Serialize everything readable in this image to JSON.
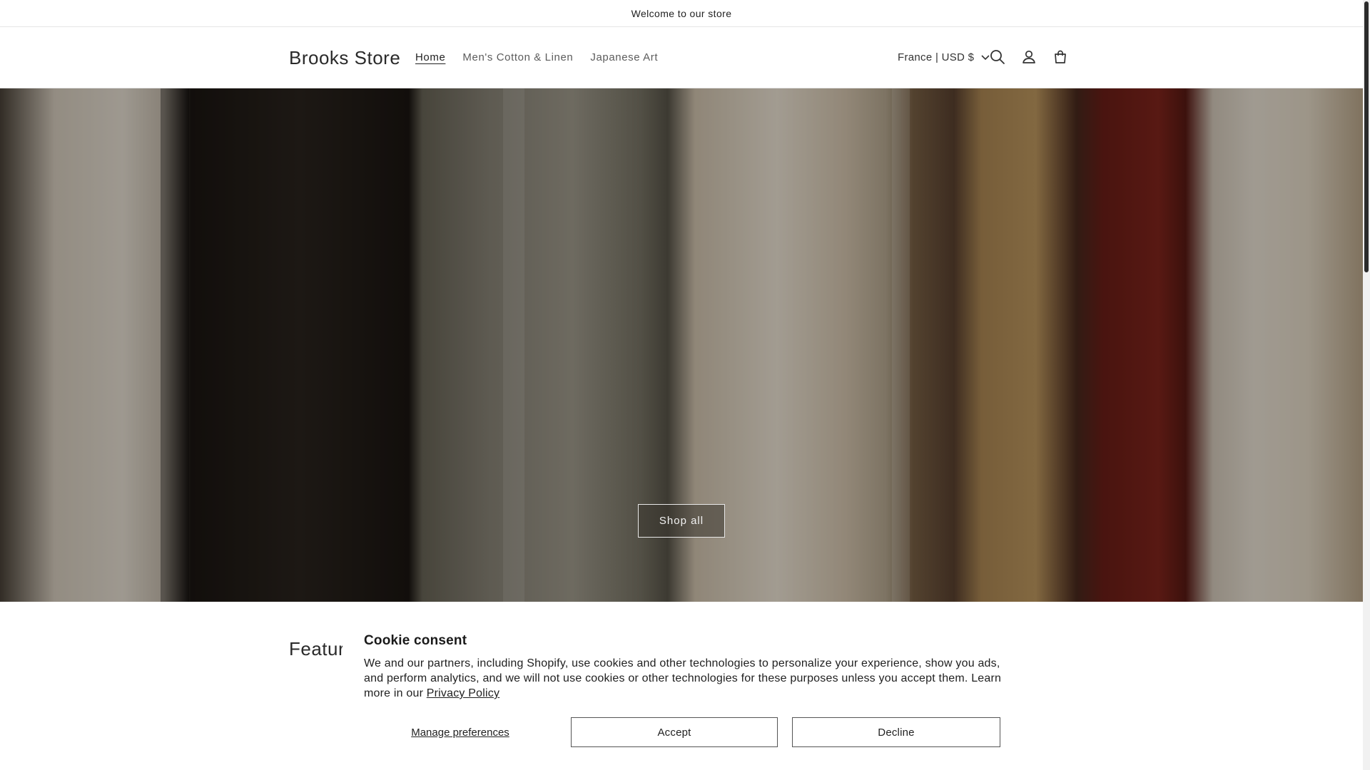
{
  "announcement": {
    "text": "Welcome to our store"
  },
  "header": {
    "logo": "Brooks Store",
    "nav": [
      {
        "label": "Home",
        "active": true
      },
      {
        "label": "Men's Cotton & Linen",
        "active": false
      },
      {
        "label": "Japanese Art",
        "active": false
      }
    ],
    "country_selector": "France | USD $",
    "icons": [
      "search-icon",
      "account-icon",
      "cart-icon"
    ]
  },
  "hero": {
    "button_label": "Shop all"
  },
  "featured": {
    "heading": "Feature"
  },
  "cookie": {
    "title": "Cookie consent",
    "body": "We and our partners, including Shopify, use cookies and other technologies to personalize your experience, show you ads, and perform analytics, and we will not use cookies or other technologies for these purposes unless you accept them. Learn more in our",
    "link": "Privacy Policy",
    "manage_label": "Manage preferences",
    "accept_label": "Accept",
    "decline_label": "Decline"
  },
  "colors": {
    "text": "#121212",
    "muted": "#5c5c5c",
    "border": "#e6e6e6"
  }
}
